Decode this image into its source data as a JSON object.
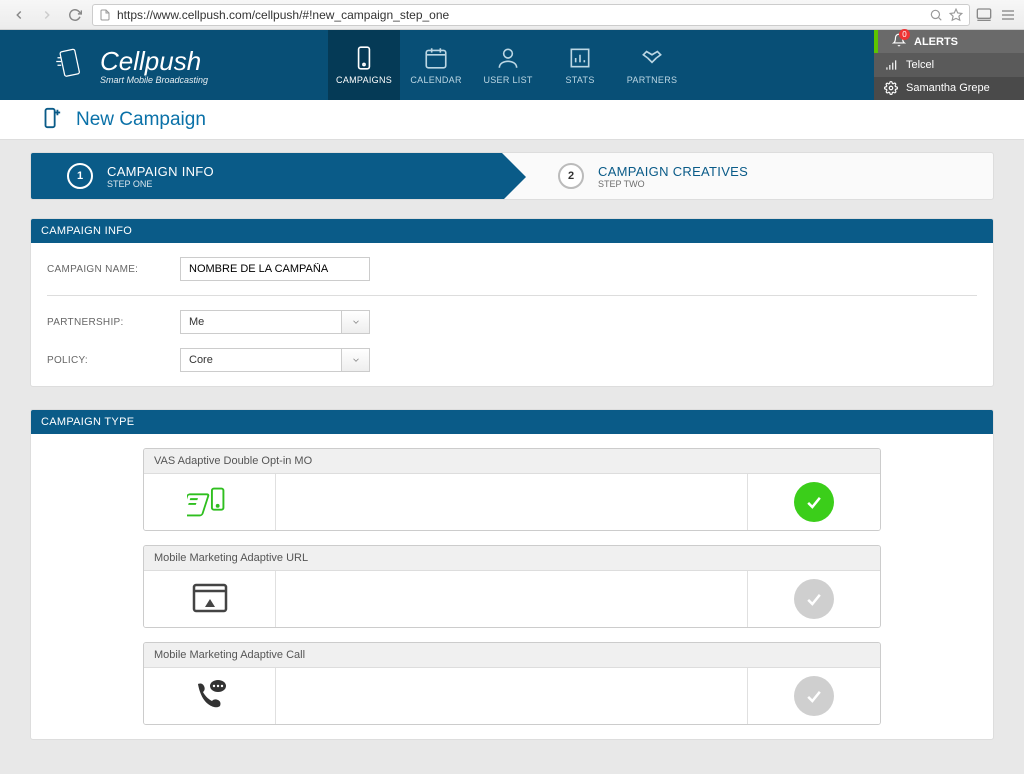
{
  "browser": {
    "url": "https://www.cellpush.com/cellpush/#!new_campaign_step_one"
  },
  "logo": {
    "name": "Cellpush",
    "tagline": "Smart Mobile Broadcasting"
  },
  "nav": {
    "campaigns": "CAMPAIGNS",
    "calendar": "CALENDAR",
    "userlist": "USER LIST",
    "stats": "STATS",
    "partners": "PARTNERS"
  },
  "side": {
    "alerts_label": "ALERTS",
    "alerts_count": "0",
    "carrier": "Telcel",
    "username": "Samantha Grepe"
  },
  "page_title": "New Campaign",
  "steps": {
    "one": {
      "num": "1",
      "title": "CAMPAIGN INFO",
      "sub": "STEP ONE"
    },
    "two": {
      "num": "2",
      "title": "CAMPAIGN CREATIVES",
      "sub": "STEP TWO"
    }
  },
  "info_panel": {
    "title": "CAMPAIGN INFO",
    "name_label": "CAMPAIGN NAME:",
    "name_value": "NOMBRE DE LA CAMPAÑA",
    "partnership_label": "PARTNERSHIP:",
    "partnership_value": "Me",
    "policy_label": "POLICY:",
    "policy_value": "Core"
  },
  "type_panel": {
    "title": "CAMPAIGN TYPE",
    "types": [
      {
        "label": "VAS Adaptive Double Opt-in MO",
        "selected": true
      },
      {
        "label": "Mobile Marketing Adaptive URL",
        "selected": false
      },
      {
        "label": "Mobile Marketing Adaptive Call",
        "selected": false
      }
    ]
  }
}
